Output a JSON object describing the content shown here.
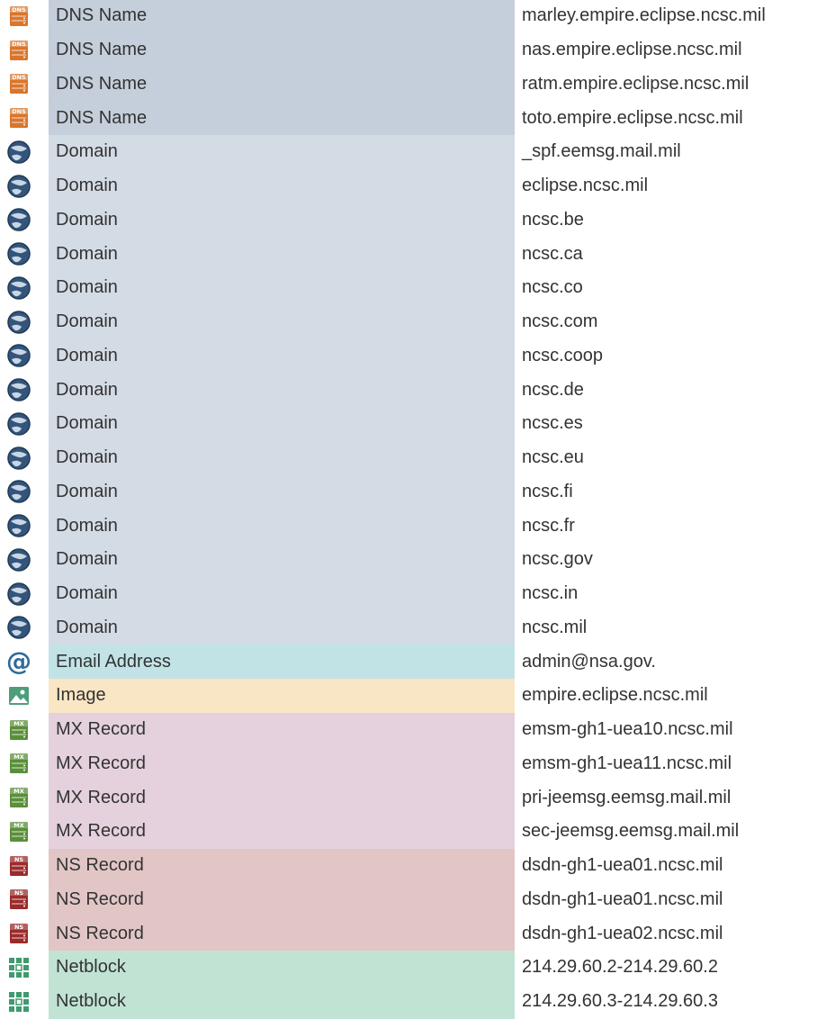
{
  "colors": {
    "dns": "#c5cfdb",
    "domain": "#d3dbe5",
    "email": "#c2e3e6",
    "image": "#f9e6c4",
    "mx": "#e4d1dd",
    "ns": "#e2c6c6",
    "netblock": "#c1e3d4"
  },
  "rows": [
    {
      "icon": "dns-server-icon",
      "type": "DNS Name",
      "value": "marley.empire.eclipse.ncsc.mil",
      "color": "#c5cfdb"
    },
    {
      "icon": "dns-server-icon",
      "type": "DNS Name",
      "value": "nas.empire.eclipse.ncsc.mil",
      "color": "#c5cfdb"
    },
    {
      "icon": "dns-server-icon",
      "type": "DNS Name",
      "value": "ratm.empire.eclipse.ncsc.mil",
      "color": "#c5cfdb"
    },
    {
      "icon": "dns-server-icon",
      "type": "DNS Name",
      "value": "toto.empire.eclipse.ncsc.mil",
      "color": "#c5cfdb"
    },
    {
      "icon": "globe-icon",
      "type": "Domain",
      "value": "_spf.eemsg.mail.mil",
      "color": "#d3dbe5"
    },
    {
      "icon": "globe-icon",
      "type": "Domain",
      "value": "eclipse.ncsc.mil",
      "color": "#d3dbe5"
    },
    {
      "icon": "globe-icon",
      "type": "Domain",
      "value": "ncsc.be",
      "color": "#d3dbe5"
    },
    {
      "icon": "globe-icon",
      "type": "Domain",
      "value": "ncsc.ca",
      "color": "#d3dbe5"
    },
    {
      "icon": "globe-icon",
      "type": "Domain",
      "value": "ncsc.co",
      "color": "#d3dbe5"
    },
    {
      "icon": "globe-icon",
      "type": "Domain",
      "value": "ncsc.com",
      "color": "#d3dbe5"
    },
    {
      "icon": "globe-icon",
      "type": "Domain",
      "value": "ncsc.coop",
      "color": "#d3dbe5"
    },
    {
      "icon": "globe-icon",
      "type": "Domain",
      "value": "ncsc.de",
      "color": "#d3dbe5"
    },
    {
      "icon": "globe-icon",
      "type": "Domain",
      "value": "ncsc.es",
      "color": "#d3dbe5"
    },
    {
      "icon": "globe-icon",
      "type": "Domain",
      "value": "ncsc.eu",
      "color": "#d3dbe5"
    },
    {
      "icon": "globe-icon",
      "type": "Domain",
      "value": "ncsc.fi",
      "color": "#d3dbe5"
    },
    {
      "icon": "globe-icon",
      "type": "Domain",
      "value": "ncsc.fr",
      "color": "#d3dbe5"
    },
    {
      "icon": "globe-icon",
      "type": "Domain",
      "value": "ncsc.gov",
      "color": "#d3dbe5"
    },
    {
      "icon": "globe-icon",
      "type": "Domain",
      "value": "ncsc.in",
      "color": "#d3dbe5"
    },
    {
      "icon": "globe-icon",
      "type": "Domain",
      "value": "ncsc.mil",
      "color": "#d3dbe5"
    },
    {
      "icon": "at-sign-icon",
      "type": "Email Address",
      "value": "admin@nsa.gov.",
      "color": "#c2e3e6"
    },
    {
      "icon": "image-icon",
      "type": "Image",
      "value": "empire.eclipse.ncsc.mil",
      "color": "#f9e6c4"
    },
    {
      "icon": "mx-server-icon",
      "type": "MX Record",
      "value": "emsm-gh1-uea10.ncsc.mil",
      "color": "#e4d1dd"
    },
    {
      "icon": "mx-server-icon",
      "type": "MX Record",
      "value": "emsm-gh1-uea11.ncsc.mil",
      "color": "#e4d1dd"
    },
    {
      "icon": "mx-server-icon",
      "type": "MX Record",
      "value": "pri-jeemsg.eemsg.mail.mil",
      "color": "#e4d1dd"
    },
    {
      "icon": "mx-server-icon",
      "type": "MX Record",
      "value": "sec-jeemsg.eemsg.mail.mil",
      "color": "#e4d1dd"
    },
    {
      "icon": "ns-server-icon",
      "type": "NS Record",
      "value": "dsdn-gh1-uea01.ncsc.mil",
      "color": "#e2c6c6"
    },
    {
      "icon": "ns-server-icon",
      "type": "NS Record",
      "value": "dsdn-gh1-uea01.ncsc.mil",
      "color": "#e2c6c6"
    },
    {
      "icon": "ns-server-icon",
      "type": "NS Record",
      "value": "dsdn-gh1-uea02.ncsc.mil",
      "color": "#e2c6c6"
    },
    {
      "icon": "netblock-icon",
      "type": "Netblock",
      "value": "214.29.60.2-214.29.60.2",
      "color": "#c1e3d4"
    },
    {
      "icon": "netblock-icon",
      "type": "Netblock",
      "value": "214.29.60.3-214.29.60.3",
      "color": "#c1e3d4"
    }
  ]
}
